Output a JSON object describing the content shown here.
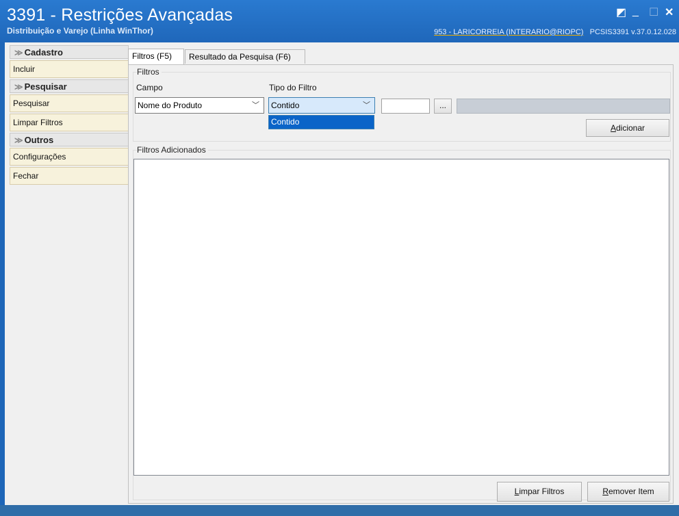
{
  "window": {
    "title": "3391 - Restrições Avançadas",
    "subtitle": "Distribuição e Varejo (Linha WinThor)",
    "user_info": "953 - LARICORREIA (INTERARIO@RIOPC)",
    "program_version": "PCSIS3391  v.37.0.12.028",
    "controls": {
      "restore": "◩",
      "minimize": "_",
      "maximize": "☐",
      "close": "✕"
    }
  },
  "sidebar": {
    "groups": [
      {
        "label": "Cadastro",
        "items": [
          "Incluir"
        ]
      },
      {
        "label": "Pesquisar",
        "items": [
          "Pesquisar",
          "Limpar Filtros"
        ]
      },
      {
        "label": "Outros",
        "items": [
          "Configurações",
          "Fechar"
        ]
      }
    ],
    "chevron_icon": "double-chevron-down-icon"
  },
  "tabs": [
    {
      "label": "Filtros (F5)",
      "active": true
    },
    {
      "label": "Resultado da Pesquisa (F6)",
      "active": false
    }
  ],
  "filters": {
    "group_label": "Filtros",
    "campo_label": "Campo",
    "campo_value": "Nome do Produto",
    "tipo_label": "Tipo do Filtro",
    "tipo_value": "Contido",
    "tipo_options": [
      "Contido"
    ],
    "ellipsis": "...",
    "add_button": {
      "accel": "A",
      "rest": "dicionar"
    }
  },
  "added": {
    "group_label": "Filtros Adicionados",
    "clear_button": {
      "accel": "L",
      "rest": "impar Filtros"
    },
    "remove_button": {
      "accel": "R",
      "rest": "emover Item"
    }
  },
  "colors": {
    "title_bar": "#1f67ba",
    "accent_underline": "#f0b000",
    "selection": "#0a64c8"
  }
}
